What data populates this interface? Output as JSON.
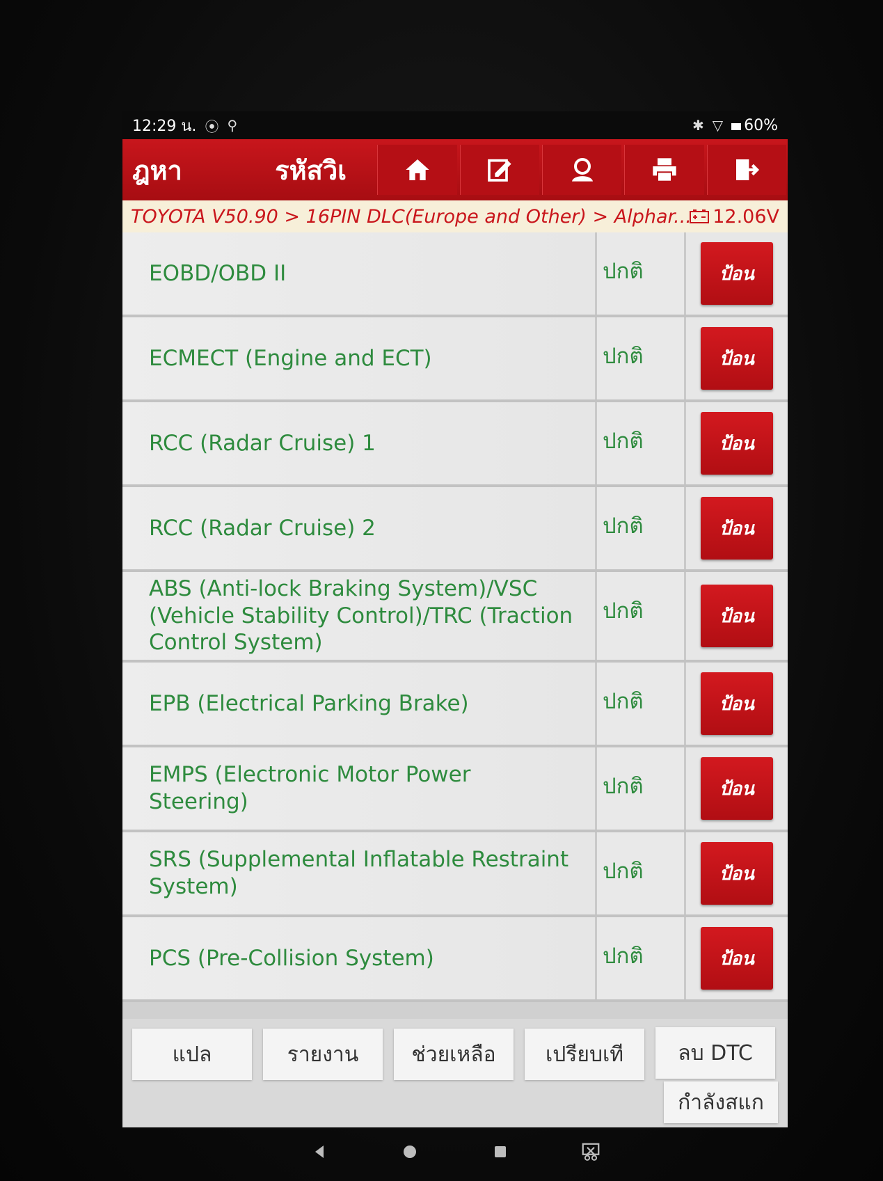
{
  "status_bar": {
    "time": "12:29 น.",
    "battery": "60%"
  },
  "toolbar": {
    "find_label": "ฎหา",
    "code_label": "รหัสวิเ",
    "buttons": [
      "home-icon",
      "edit-icon",
      "user-icon",
      "print-icon",
      "exit-icon"
    ]
  },
  "breadcrumb": {
    "path": "TOYOTA V50.90 > 16PIN DLC(Europe and Other) > Alphar...",
    "voltage": "12.06V"
  },
  "systems": [
    {
      "name": "EOBD/OBD II",
      "status": "ปกติ",
      "action": "ป้อน"
    },
    {
      "name": "ECMECT (Engine and ECT)",
      "status": "ปกติ",
      "action": "ป้อน"
    },
    {
      "name": "RCC (Radar Cruise) 1",
      "status": "ปกติ",
      "action": "ป้อน"
    },
    {
      "name": "RCC (Radar Cruise) 2",
      "status": "ปกติ",
      "action": "ป้อน"
    },
    {
      "name": "ABS (Anti-lock Braking System)/VSC (Vehicle Stability Control)/TRC (Traction Control System)",
      "status": "ปกติ",
      "action": "ป้อน"
    },
    {
      "name": "EPB (Electrical Parking Brake)",
      "status": "ปกติ",
      "action": "ป้อน"
    },
    {
      "name": "EMPS (Electronic Motor Power Steering)",
      "status": "ปกติ",
      "action": "ป้อน"
    },
    {
      "name": "SRS (Supplemental Inflatable Restraint System)",
      "status": "ปกติ",
      "action": "ป้อน"
    },
    {
      "name": "PCS (Pre-Collision System)",
      "status": "ปกติ",
      "action": "ป้อน"
    }
  ],
  "bottom_buttons": {
    "translate": "แปล",
    "report": "รายงาน",
    "help": "ช่วยเหลือ",
    "compare": "เปรียบเที",
    "clear_dtc": "ลบ DTC",
    "scanning": "กำลังสแก"
  }
}
